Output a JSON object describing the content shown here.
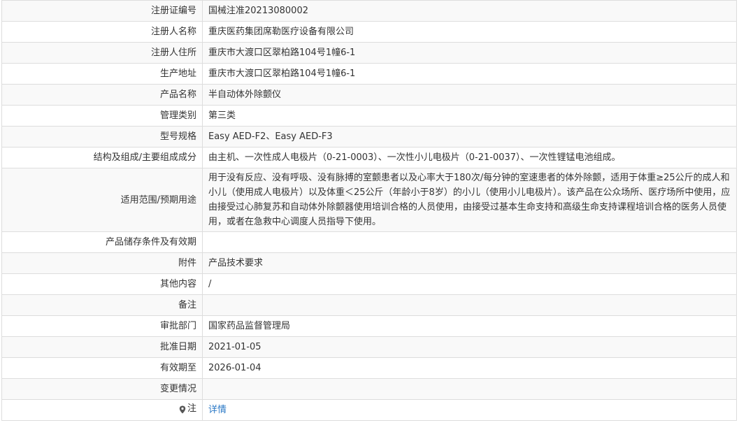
{
  "rows": [
    {
      "label": "注册证编号",
      "value": "国械注准20213080002"
    },
    {
      "label": "注册人名称",
      "value": "重庆医药集团席勒医疗设备有限公司"
    },
    {
      "label": "注册人住所",
      "value": "重庆市大渡口区翠柏路104号1幢6-1"
    },
    {
      "label": "生产地址",
      "value": "重庆市大渡口区翠柏路104号1幢6-1"
    },
    {
      "label": "产品名称",
      "value": "半自动体外除颤仪"
    },
    {
      "label": "管理类别",
      "value": "第三类"
    },
    {
      "label": "型号规格",
      "value": "Easy AED-F2、Easy AED-F3"
    },
    {
      "label": "结构及组成/主要组成成分",
      "value": "由主机、一次性成人电极片（0-21-0003）、一次性小儿电极片（0-21-0037）、一次性锂锰电池组成。"
    },
    {
      "label": "适用范围/预期用途",
      "value": "用于没有反应、没有呼吸、没有脉搏的室颤患者以及心率大于180次/每分钟的室速患者的体外除颤，适用于体重≥25公斤的成人和小儿（使用成人电极片）以及体重＜25公斤（年龄小于8岁）的小儿（使用小儿电极片）。该产品在公众场所、医疗场所中使用，应由接受过心肺复苏和自动体外除颤器使用培训合格的人员使用，由接受过基本生命支持和高级生命支持课程培训合格的医务人员使用，或者在急救中心调度人员指导下使用。"
    },
    {
      "label": "产品储存条件及有效期",
      "value": ""
    },
    {
      "label": "附件",
      "value": "产品技术要求"
    },
    {
      "label": "其他内容",
      "value": "/"
    },
    {
      "label": "备注",
      "value": ""
    },
    {
      "label": "审批部门",
      "value": "国家药品监督管理局"
    },
    {
      "label": "批准日期",
      "value": "2021-01-05"
    },
    {
      "label": "有效期至",
      "value": "2026-01-04"
    },
    {
      "label": "变更情况",
      "value": ""
    },
    {
      "label": "注",
      "value": "详情"
    }
  ],
  "icons": {
    "note": "location-pin-icon"
  }
}
